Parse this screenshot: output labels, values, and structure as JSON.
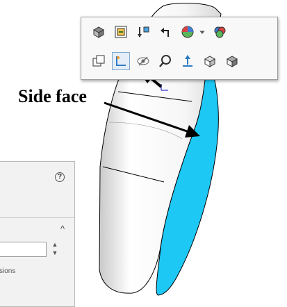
{
  "callout": {
    "text": "Side face"
  },
  "toolbar": {
    "rows": [
      [
        "zoom-to-fit-icon",
        "section-view-icon",
        "view-orientation-icon",
        "previous-view-icon",
        "appearance-icon",
        "dropdown-arrow-icon",
        "apply-scene-icon"
      ],
      [
        "normal-to-icon",
        "sketch-icon",
        "hide-show-icon",
        "zoom-to-selection-icon",
        "insert-axis-icon",
        "isometric-view-icon",
        "shaded-display-icon"
      ]
    ],
    "active_item": "sketch-icon"
  },
  "panel": {
    "help_glyph": "?",
    "collapse_glyph": "^",
    "input_value": "",
    "visible_text": "sions"
  },
  "colors": {
    "side_face": "#1ec8f5",
    "model_shade_light": "#ffffff",
    "model_shade_dark": "#bdbdbd",
    "edge": "#000000",
    "toolbar_bg": "#f8f8f8",
    "panel_bg": "#f2f2f2"
  }
}
